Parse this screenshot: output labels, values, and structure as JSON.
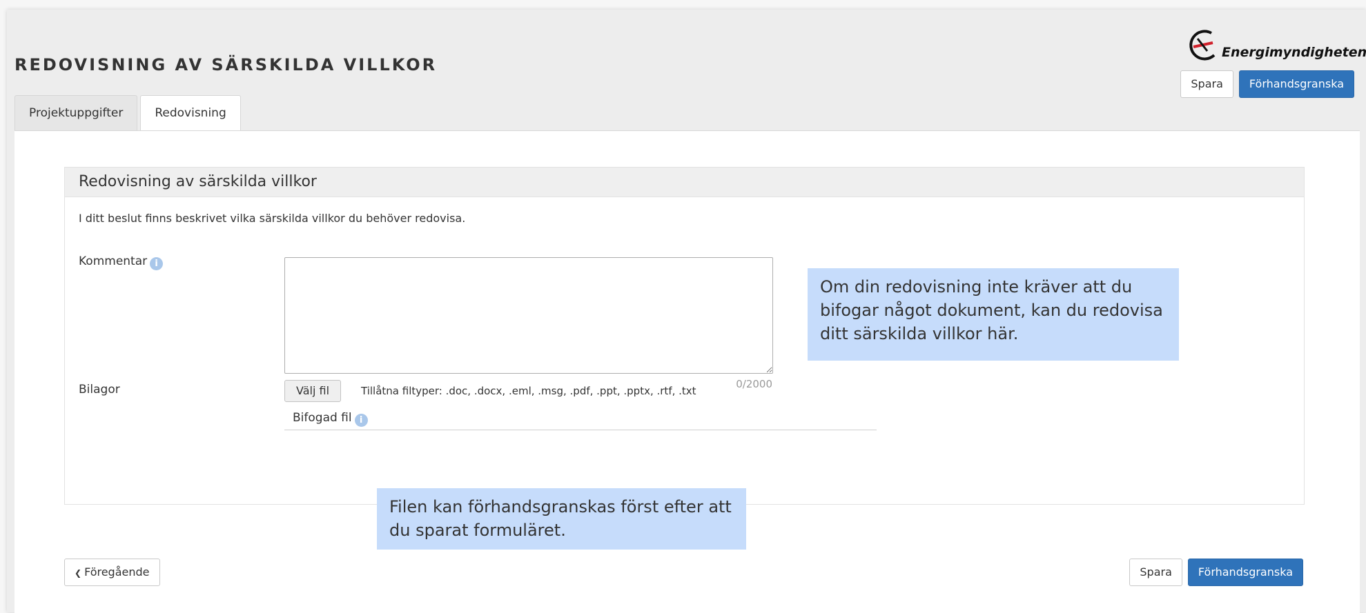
{
  "header": {
    "title": "REDOVISNING AV SÄRSKILDA VILLKOR",
    "logo_text": "Energimyndigheten",
    "save_label": "Spara",
    "preview_label": "Förhandsgranska"
  },
  "tabs": [
    {
      "label": "Projektuppgifter",
      "active": false
    },
    {
      "label": "Redovisning",
      "active": true
    }
  ],
  "panel": {
    "title": "Redovisning av särskilda villkor",
    "intro": "I ditt beslut finns beskrivet vilka särskilda villkor du behöver redovisa.",
    "comment_label": "Kommentar",
    "comment_value": "",
    "counter": "0/2000",
    "attachments_label": "Bilagor",
    "choose_file_label": "Välj fil",
    "allowed_types": "Tillåtna filtyper: .doc, .docx, .eml, .msg, .pdf, .ppt, .pptx, .rtf, .txt",
    "attached_file_label": "Bifogad fil"
  },
  "tooltips": {
    "comment": "Om din redovisning inte kräver att du bifogar något dokument, kan du redovisa ditt särskilda villkor här.",
    "file": "Filen kan förhandsgranskas först efter att du sparat formuläret."
  },
  "footer": {
    "previous_label": "Föregående",
    "save_label": "Spara",
    "preview_label": "Förhandsgranska"
  },
  "colors": {
    "primary": "#2f73ba",
    "tooltip": "#c6dcfb",
    "info_icon": "#a9c7ea"
  }
}
